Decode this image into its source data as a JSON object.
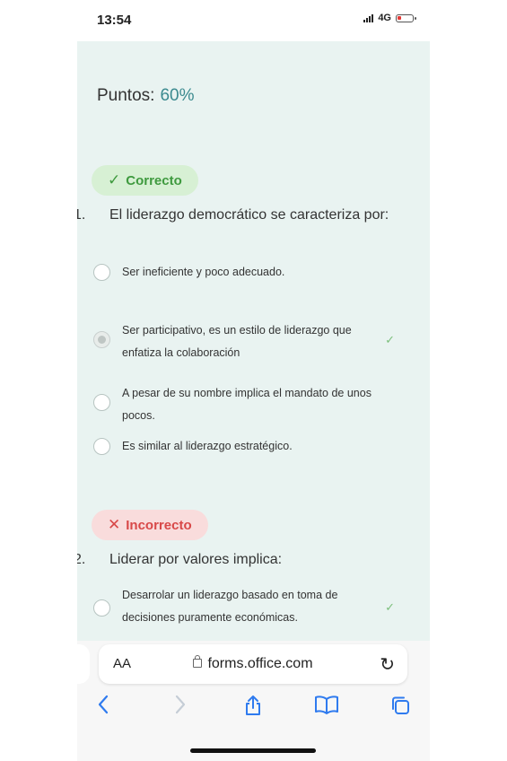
{
  "status_bar": {
    "time": "13:54",
    "network": "4G"
  },
  "score": {
    "label": "Puntos:",
    "value": "60%"
  },
  "questions": [
    {
      "result": {
        "glyph": "✓",
        "label": "Correcto"
      },
      "number": "1.",
      "text": "El liderazgo democrático se caracteriza por:",
      "options": [
        {
          "text": "Ser ineficiente y poco adecuado.",
          "selected": false,
          "correct": false
        },
        {
          "text": "Ser participativo, es un estilo de liderazgo que enfatiza la colaboración",
          "selected": true,
          "correct": true
        },
        {
          "text": "A pesar de su nombre implica el mandato de unos pocos.",
          "selected": false,
          "correct": false
        },
        {
          "text": "Es similar al liderazgo estratégico.",
          "selected": false,
          "correct": false
        }
      ]
    },
    {
      "result": {
        "glyph": "✕",
        "label": "Incorrecto"
      },
      "number": "2.",
      "text": "Liderar por valores implica:",
      "options": [
        {
          "text": "Desarrolar un liderazgo basado en toma de decisiones puramente económicas.",
          "selected": false,
          "correct": true
        }
      ]
    }
  ],
  "browser": {
    "text_size_label": "AA",
    "url": "forms.office.com",
    "toolbar": [
      "back-icon",
      "forward-icon",
      "share-icon",
      "bookmarks-icon",
      "tabs-icon"
    ]
  },
  "colors": {
    "background": "#e9f3f1",
    "accent": "#3b8a8f",
    "correct": "#3f9a3f",
    "incorrect": "#d84848",
    "link": "#2f7bef"
  }
}
